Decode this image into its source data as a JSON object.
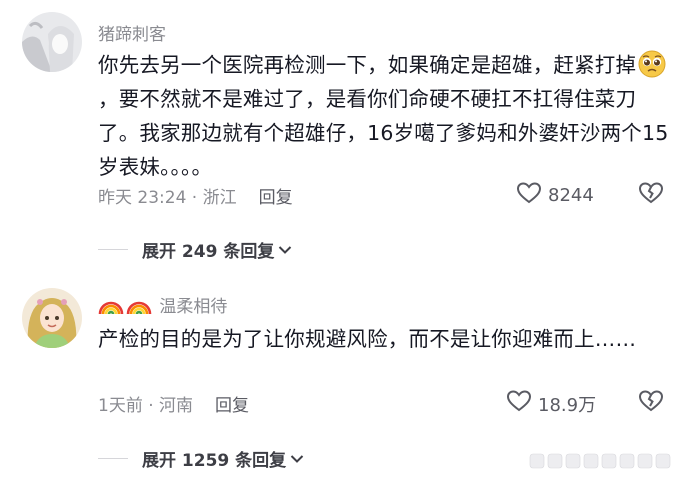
{
  "comments": [
    {
      "username": "猪蹄刺客",
      "text_parts": [
        "你先去另一个医院再检测一下，如果确定是超雄，赶紧打掉",
        "，要不然就不是难过了，是看你们命硬不硬扛不扛得住菜刀了。我家那边就有个超雄仔，16岁噶了爹妈和外婆奸沙两个15岁表妹。。。。"
      ],
      "emoji": "pleading-face",
      "time_location": "昨天 23:24 · 浙江",
      "reply_label": "回复",
      "likes": "8244",
      "expand_label": "展开 249 条回复"
    },
    {
      "username_prefix": "🌈🌈",
      "username": "温柔相待",
      "text": "产检的目的是为了让你规避风险，而不是让你迎难而上……",
      "time_location": "1天前 · 河南",
      "reply_label": "回复",
      "likes": "18.9万",
      "expand_label": "展开 1259 条回复"
    }
  ],
  "colors": {
    "text": "#161823",
    "meta": "#8a8b91",
    "accent_gray": "#5a5b63"
  }
}
